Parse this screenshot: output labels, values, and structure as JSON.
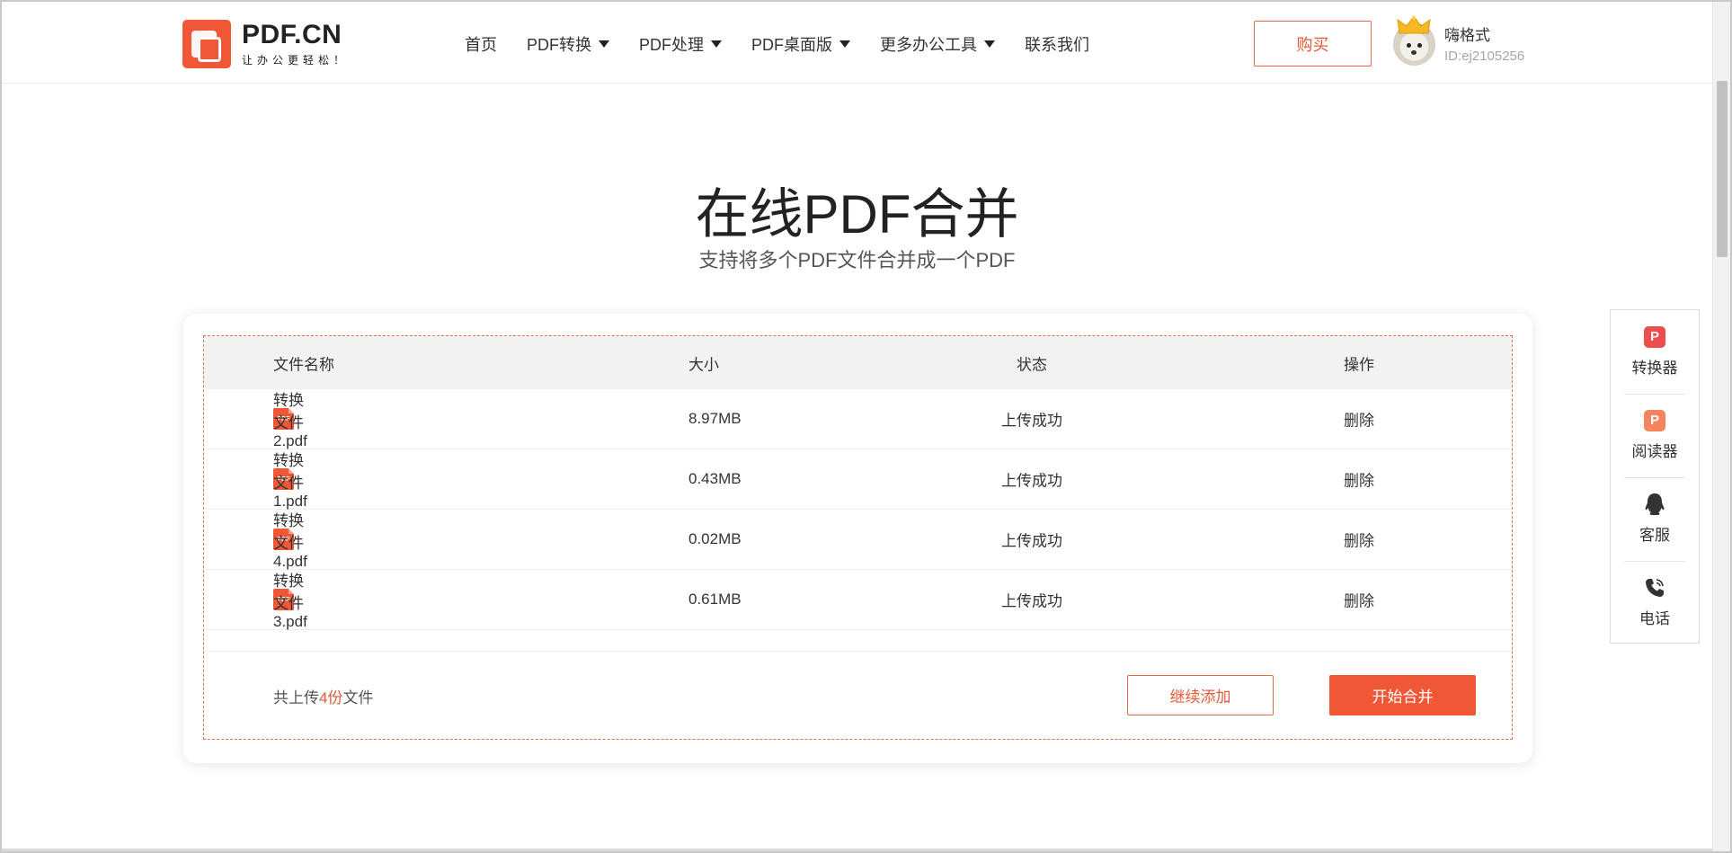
{
  "brand": {
    "name": "PDF.CN",
    "slogan": "让办公更轻松！"
  },
  "nav": {
    "items": [
      {
        "label": "首页",
        "dropdown": false
      },
      {
        "label": "PDF转换",
        "dropdown": true
      },
      {
        "label": "PDF处理",
        "dropdown": true
      },
      {
        "label": "PDF桌面版",
        "dropdown": true
      },
      {
        "label": "更多办公工具",
        "dropdown": true
      },
      {
        "label": "联系我们",
        "dropdown": false
      }
    ]
  },
  "header": {
    "buy_label": "购买",
    "user_name": "嗨格式",
    "user_id": "ID:ej2105256"
  },
  "page": {
    "title": "在线PDF合并",
    "subtitle": "支持将多个PDF文件合并成一个PDF"
  },
  "table": {
    "headers": {
      "name": "文件名称",
      "size": "大小",
      "status": "状态",
      "op": "操作"
    },
    "rows": [
      {
        "name": "转换文件2.pdf",
        "size": "8.97MB",
        "status": "上传成功",
        "op": "删除"
      },
      {
        "name": "转换文件1.pdf",
        "size": "0.43MB",
        "status": "上传成功",
        "op": "删除"
      },
      {
        "name": "转换文件4.pdf",
        "size": "0.02MB",
        "status": "上传成功",
        "op": "删除"
      },
      {
        "name": "转换文件3.pdf",
        "size": "0.61MB",
        "status": "上传成功",
        "op": "删除"
      }
    ],
    "file_icon_text": "PDF"
  },
  "footer": {
    "count_prefix": "共上传",
    "count_value": "4份",
    "count_suffix": "文件",
    "add_label": "继续添加",
    "merge_label": "开始合并"
  },
  "float_panel": {
    "items": [
      {
        "label": "转换器",
        "icon": "converter-icon"
      },
      {
        "label": "阅读器",
        "icon": "reader-icon"
      },
      {
        "label": "客服",
        "icon": "qq-icon"
      },
      {
        "label": "电话",
        "icon": "phone-icon"
      }
    ]
  },
  "colors": {
    "accent": "#ef5736",
    "accent_text": "#e55a39",
    "header_row_bg": "#f2f2f2"
  }
}
